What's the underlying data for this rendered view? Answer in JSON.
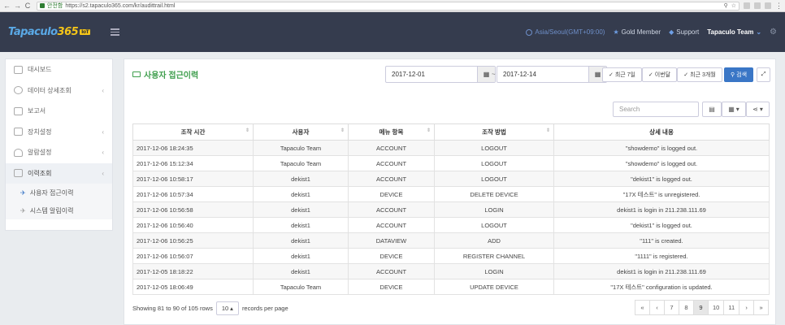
{
  "browser": {
    "back": "←",
    "forward": "→",
    "reload": "C",
    "secure_label": "안전함",
    "url": "https://s2.tapaculo365.com/kr/audittrail.html",
    "zoom_icon": "zoom-icon",
    "bookmark_icon": "star-icon"
  },
  "topbar": {
    "logo_text": "Tapaculo",
    "logo_suffix": "365",
    "logo_badge": "IoT",
    "timezone": "Asia/Seoul(GMT+09:00)",
    "membership": "Gold Member",
    "support": "Support",
    "team": "Tapaculo Team",
    "colors": {
      "bar": "#353c4e",
      "accent": "#5aa9e6"
    }
  },
  "sidebar": {
    "items": [
      {
        "label": "대시보드",
        "chev": ""
      },
      {
        "label": "데이터 상세조회",
        "chev": "‹"
      },
      {
        "label": "보고서",
        "chev": ""
      },
      {
        "label": "장치설정",
        "chev": "‹"
      },
      {
        "label": "알람설정",
        "chev": "‹"
      },
      {
        "label": "이력조회",
        "chev": "‹"
      }
    ],
    "sub": [
      {
        "label": "사용자 접근이력"
      },
      {
        "label": "시스템 알림이력"
      }
    ]
  },
  "main": {
    "title": "사용자 접근이력",
    "date_from": "2017-12-01",
    "date_to": "2017-12-14",
    "tilde": "~",
    "btn_7days": "최근 7일",
    "btn_week": "이번달",
    "btn_3months": "최근 3개월",
    "btn_search": "검색",
    "search_placeholder": "Search"
  },
  "table": {
    "headers": [
      "조작 시간",
      "사용자",
      "메뉴 항목",
      "조작 방법",
      "상세 내용"
    ],
    "rows": [
      [
        "2017-12-06 18:24:35",
        "Tapaculo Team",
        "ACCOUNT",
        "LOGOUT",
        "\"showdemo\" is logged out."
      ],
      [
        "2017-12-06 15:12:34",
        "Tapaculo Team",
        "ACCOUNT",
        "LOGOUT",
        "\"showdemo\" is logged out."
      ],
      [
        "2017-12-06 10:58:17",
        "dekist1",
        "ACCOUNT",
        "LOGOUT",
        "\"dekist1\" is logged out."
      ],
      [
        "2017-12-06 10:57:34",
        "dekist1",
        "DEVICE",
        "DELETE DEVICE",
        "\"17X 테스트\" is unregistered."
      ],
      [
        "2017-12-06 10:56:58",
        "dekist1",
        "ACCOUNT",
        "LOGIN",
        "dekist1 is login in 211.238.111.69"
      ],
      [
        "2017-12-06 10:56:40",
        "dekist1",
        "ACCOUNT",
        "LOGOUT",
        "\"dekist1\" is logged out."
      ],
      [
        "2017-12-06 10:56:25",
        "dekist1",
        "DATAVIEW",
        "ADD",
        "\"111\" is created."
      ],
      [
        "2017-12-06 10:56:07",
        "dekist1",
        "DEVICE",
        "REGISTER CHANNEL",
        "\"1111\" is registered."
      ],
      [
        "2017-12-05 18:18:22",
        "dekist1",
        "ACCOUNT",
        "LOGIN",
        "dekist1 is login in 211.238.111.69"
      ],
      [
        "2017-12-05 18:06:49",
        "Tapaculo Team",
        "DEVICE",
        "UPDATE DEVICE",
        "\"17X 테스트\" configuration is updated."
      ]
    ]
  },
  "footer": {
    "showing": "Showing 81 to 90 of 105 rows",
    "page_size": "10",
    "records_per_page": "records per page",
    "pages": [
      "«",
      "‹",
      "7",
      "8",
      "9",
      "10",
      "11",
      "›",
      "»"
    ],
    "current_page": "9"
  }
}
